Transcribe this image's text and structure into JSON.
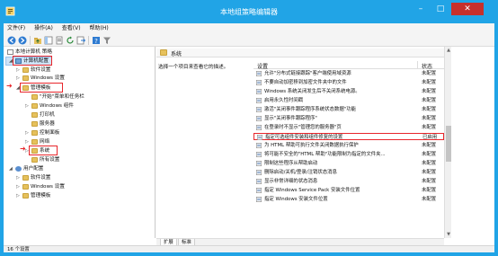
{
  "window": {
    "title": "本地组策略编辑器"
  },
  "menu": [
    "文件(F)",
    "操作(A)",
    "查看(V)",
    "帮助(H)"
  ],
  "toolbar": [
    "back-icon",
    "forward-icon",
    "up-folder-icon",
    "show-tree-icon",
    "properties-icon",
    "refresh-icon",
    "export-list-icon",
    "help-icon",
    "filter-icon"
  ],
  "tree": {
    "root": "本地计算机 策略",
    "computer_config": "计算机配置",
    "software_settings": "软件设置",
    "windows_settings": "Windows 设置",
    "admin_templates": "管理模板",
    "start_menu": "\"开始\"菜单和任务栏",
    "windows_components": "Windows 组件",
    "printers": "打印机",
    "servers": "服务器",
    "control_panel": "控制面板",
    "network": "网络",
    "system": "系统",
    "all_settings": "所有设置",
    "user_config": "用户配置",
    "user_software_settings": "软件设置",
    "user_windows_settings": "Windows 设置",
    "user_admin_templates": "管理模板"
  },
  "right": {
    "folder_title": "系统",
    "description": "选择一个项目来查看它的描述。",
    "col_setting": "设置",
    "col_state": "状态",
    "settings": [
      {
        "text": "允许\"分布式链接跟踪\"客户端使用域资源",
        "state": "未配置"
      },
      {
        "text": "不要自动加密移到加密文件夹中的文件",
        "state": "未配置"
      },
      {
        "text": "Windows 系统关闭发生后不关闭系统电源。",
        "state": "未配置"
      },
      {
        "text": "启用永久性时间戳",
        "state": "未配置"
      },
      {
        "text": "激活\"关闭事件跟踪程序系统状态数据\"功能",
        "state": "未配置"
      },
      {
        "text": "显示\"关闭事件跟踪程序\"",
        "state": "未配置"
      },
      {
        "text": "在登录时不显示\"管理您的服务器\"页",
        "state": "未配置"
      },
      {
        "text": "指定可选组件安装和组件修复的设置",
        "state": "已启用"
      },
      {
        "text": "为 HTML 帮助可执行文件关闭数据执行保护",
        "state": "未配置"
      },
      {
        "text": "将可能不安全的\"HTML 帮助\"功能限制为指定的文件夹...",
        "state": "未配置"
      },
      {
        "text": "限制这些程序从帮助启动",
        "state": "未配置"
      },
      {
        "text": "删除启动/关机/登录/注销状态消息",
        "state": "未配置"
      },
      {
        "text": "显示非常详细的状态消息",
        "state": "未配置"
      },
      {
        "text": "指定 Windows Service Pack 安装文件位置",
        "state": "未配置"
      },
      {
        "text": "指定 Windows 安装文件位置",
        "state": "未配置"
      }
    ]
  },
  "tabs": {
    "extended": "扩展",
    "standard": "标准"
  },
  "status": {
    "count": "16 个设置"
  },
  "colors": {
    "accent": "#21a4e6",
    "highlight": "#e8262b",
    "close": "#c7302b"
  }
}
